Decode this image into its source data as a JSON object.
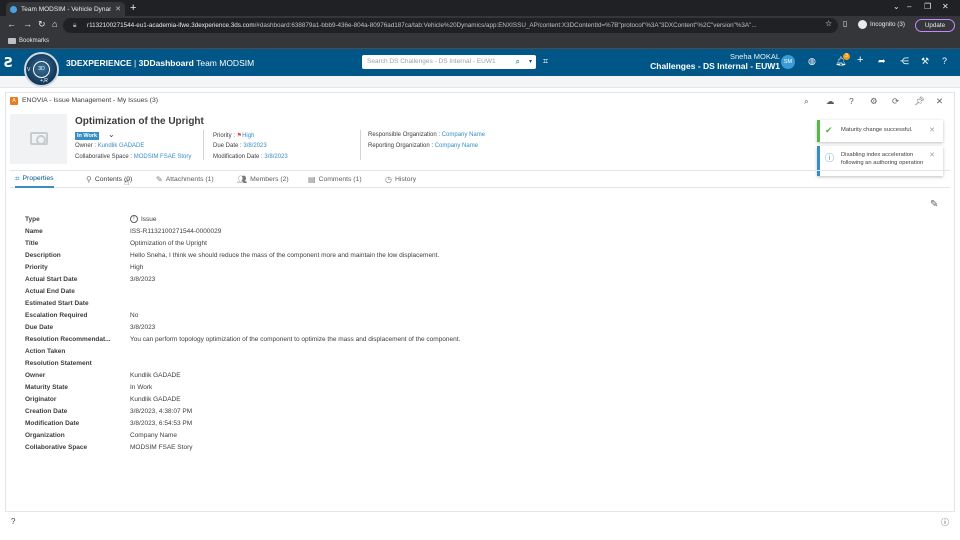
{
  "browser": {
    "tab_title": "Team MODSIM - Vehicle Dynami",
    "url_host": "r1132100271544-eu1-academia-ifwe.3dexperience.3ds.com",
    "url_rest": "/#dashboard:638879a1-bbb9-436e-804a-80976ad187ca/tab:Vehicle%20Dynamics/app:ENXISSU_AP/content:X3DContentId=%7B\"protocol\"%3A\"3DXContent\"%2C\"version\"%3A\"...",
    "incognito_label": "Incognito (3)",
    "update_label": "Update",
    "bookmarks_label": "Bookmarks"
  },
  "topbar": {
    "brand_prefix": "3DEXPERIENCE",
    "brand_app": "3DDashboard",
    "brand_team": "Team MODSIM",
    "search_placeholder": "Search DS Challenges - DS Internal - EUW1",
    "user_name": "Sneha MOKAL",
    "context": "Challenges - DS Internal - EUW1",
    "avatar_initials": "SM",
    "notification_count": "3",
    "compass_top": "3D",
    "compass_left": "V",
    "compass_bottom": "+,R"
  },
  "widget": {
    "title": "ENOVIA - Issue Management - My Issues (3)",
    "app_icon_letter": "A"
  },
  "issue": {
    "title": "Optimization of the Upright",
    "state": "In Work",
    "owner_label": "Owner : ",
    "owner_value": "Kundlik GADADE",
    "collab_label": "Collaborative Space : ",
    "collab_value": "MODSIM FSAE Story",
    "priority_label": "Priority : ",
    "priority_value": "High",
    "due_label": "Due Date : ",
    "due_value": "3/8/2023",
    "mod_label": "Modification Date : ",
    "mod_value": "3/8/2023",
    "resp_org_label": "Responsible Organization : ",
    "resp_org_value": "Company Name",
    "rep_org_label": "Reporting Organization : ",
    "rep_org_value": "Company Name"
  },
  "notifications": [
    {
      "text": "Maturity change successful.",
      "color": "#57b847"
    },
    {
      "text_line1": "Disabling index acceleration",
      "text_line2": "following an authoring operation",
      "color": "#368ec4"
    }
  ],
  "tabs": [
    {
      "label": "Properties",
      "icon": "tag-icon"
    },
    {
      "label": "Contents (0)",
      "icon": "pin-icon"
    },
    {
      "label": "Attachments (1)",
      "icon": "paperclip-icon"
    },
    {
      "label": "Members (2)",
      "icon": "members-icon"
    },
    {
      "label": "Comments (1)",
      "icon": "comments-icon"
    },
    {
      "label": "History",
      "icon": "history-icon"
    }
  ],
  "properties": [
    {
      "label": "Type",
      "value": "Issue"
    },
    {
      "label": "Name",
      "value": "ISS-R1132100271544-0000029"
    },
    {
      "label": "Title",
      "value": "Optimization of the Upright"
    },
    {
      "label": "Description",
      "value": "Hello Sneha, I think we should reduce the mass of the component more and maintain the low displacement."
    },
    {
      "label": "Priority",
      "value": "High"
    },
    {
      "label": "Actual Start Date",
      "value": "3/8/2023"
    },
    {
      "label": "Actual End Date",
      "value": ""
    },
    {
      "label": "Estimated Start Date",
      "value": ""
    },
    {
      "label": "Escalation Required",
      "value": "No"
    },
    {
      "label": "Due Date",
      "value": "3/8/2023"
    },
    {
      "label": "Resolution Recommendat...",
      "value": "You can perform topology optimization of the component to optimize the mass and displacement of the component."
    },
    {
      "label": "Action Taken",
      "value": ""
    },
    {
      "label": "Resolution Statement",
      "value": ""
    },
    {
      "label": "Owner",
      "value": "Kundlik GADADE"
    },
    {
      "label": "Maturity State",
      "value": "In Work"
    },
    {
      "label": "Originator",
      "value": "Kundlik GADADE"
    },
    {
      "label": "Creation Date",
      "value": "3/8/2023, 4:38:07 PM"
    },
    {
      "label": "Modification Date",
      "value": "3/8/2023, 6:54:53 PM"
    },
    {
      "label": "Organization",
      "value": "Company Name"
    },
    {
      "label": "Collaborative Space",
      "value": "MODSIM FSAE Story"
    }
  ],
  "colors": {
    "topbar": "#005686",
    "accent": "#368ec4",
    "state_badge": "#368ec4",
    "success": "#57b847"
  }
}
